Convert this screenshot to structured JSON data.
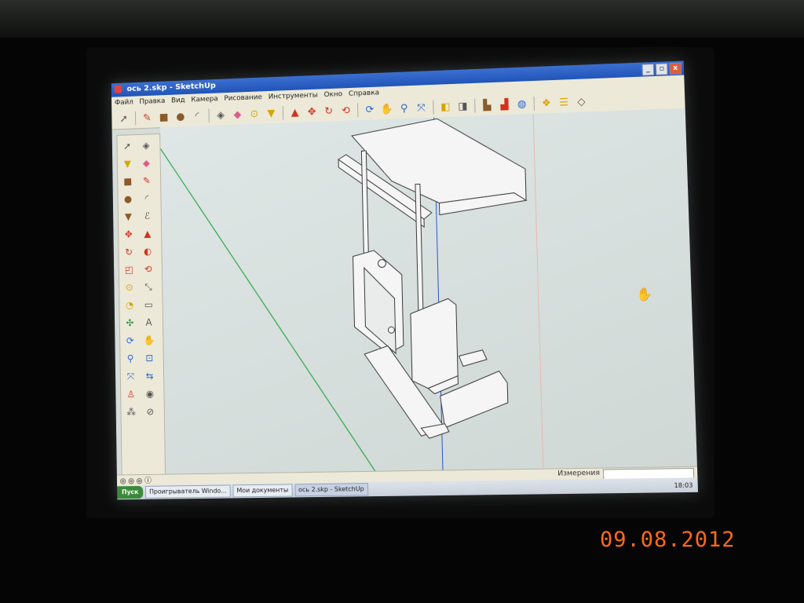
{
  "window": {
    "title": "ось 2.skp - SketchUp",
    "btn_min": "_",
    "btn_max": "▫",
    "btn_close": "x"
  },
  "menu": [
    "Файл",
    "Правка",
    "Вид",
    "Камера",
    "Рисование",
    "Инструменты",
    "Окно",
    "Справка"
  ],
  "toolbar_icons": [
    "select-arrow-icon",
    "pencil-line-icon",
    "rectangle-icon",
    "circle-icon",
    "arc-icon",
    "make-component-icon",
    "eraser-icon",
    "tape-measure-icon",
    "paint-bucket-icon",
    "push-pull-icon",
    "move-icon",
    "rotate-icon",
    "offset-icon",
    "orbit-icon",
    "pan-hand-icon",
    "zoom-icon",
    "zoom-extents-icon",
    "previous-view-icon",
    "next-view-icon",
    "warehouse-get-icon",
    "warehouse-share-icon",
    "google-earth-icon",
    "components-icon",
    "layers-icon",
    "styles-icon"
  ],
  "left_tools": [
    "select-arrow-icon",
    "component-icon",
    "paint-bucket-icon",
    "eraser-icon",
    "rectangle-icon",
    "line-icon",
    "circle-icon",
    "arc-icon",
    "polygon-icon",
    "freehand-icon",
    "move-icon",
    "push-pull-icon",
    "rotate-icon",
    "follow-me-icon",
    "scale-icon",
    "offset-icon",
    "tape-measure-icon",
    "dimension-icon",
    "protractor-icon",
    "text-icon",
    "axes-icon",
    "3d-text-icon",
    "orbit-icon",
    "pan-hand-icon",
    "zoom-icon",
    "zoom-window-icon",
    "zoom-extents-icon",
    "previous-view-icon",
    "position-camera-icon",
    "look-around-icon",
    "walk-icon",
    "section-plane-icon"
  ],
  "status": {
    "measurements_label": "Измерения",
    "measurements_value": ""
  },
  "taskbar": {
    "start": "Пуск",
    "tasks": [
      "Проигрыватель Windo...",
      "Мои документы",
      "ось 2.skp - SketchUp"
    ],
    "clock": "18:03"
  },
  "photo_date_stamp": "09.08.2012",
  "colors": {
    "canvas_bg": "#d9e1df",
    "green_axis": "#2fa34a",
    "blue_axis": "#2a55d8",
    "red_axis": "#d24a3a",
    "date_stamp": "#ff6a1a"
  }
}
